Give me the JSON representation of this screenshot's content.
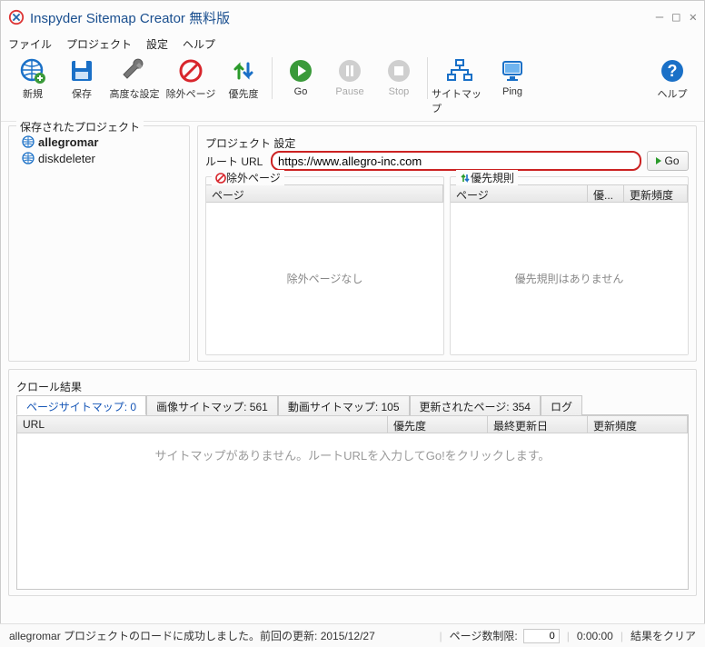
{
  "window": {
    "title": "Inspyder Sitemap Creator 無料版"
  },
  "menus": [
    "ファイル",
    "プロジェクト",
    "設定",
    "ヘルプ"
  ],
  "toolbar": {
    "new": "新規",
    "save": "保存",
    "advanced": "高度な設定",
    "exclude": "除外ページ",
    "priority": "優先度",
    "go": "Go",
    "pause": "Pause",
    "stop": "Stop",
    "sitemap": "サイトマップ",
    "ping": "Ping",
    "help": "ヘルプ"
  },
  "saved_projects": {
    "label": "保存されたプロジェクト",
    "items": [
      {
        "name": "allegromar",
        "selected": true
      },
      {
        "name": "diskdeleter",
        "selected": false
      }
    ]
  },
  "project_settings": {
    "label": "プロジェクト 設定",
    "root_url_label": "ルート URL",
    "root_url_value": "https://www.allegro-inc.com",
    "go_label": "Go",
    "exclude_label": "除外ページ",
    "exclude_cols": [
      "ページ"
    ],
    "exclude_empty": "除外ページなし",
    "priority_label": "優先規則",
    "priority_cols": [
      "ページ",
      "優...",
      "更新頻度"
    ],
    "priority_empty": "優先規則はありません"
  },
  "crawl": {
    "label": "クロール結果",
    "tabs": [
      "ページサイトマップ: 0",
      "画像サイトマップ: 561",
      "動画サイトマップ: 105",
      "更新されたページ: 354",
      "ログ"
    ],
    "cols": [
      "URL",
      "優先度",
      "最終更新日",
      "更新頻度"
    ],
    "empty": "サイトマップがありません。ルートURLを入力してGo!をクリックします。"
  },
  "status": {
    "msg": "allegromar プロジェクトのロードに成功しました。前回の更新: 2015/12/27",
    "limit_label": "ページ数制限:",
    "limit_value": "0",
    "timer": "0:00:00",
    "clear": "結果をクリア"
  }
}
